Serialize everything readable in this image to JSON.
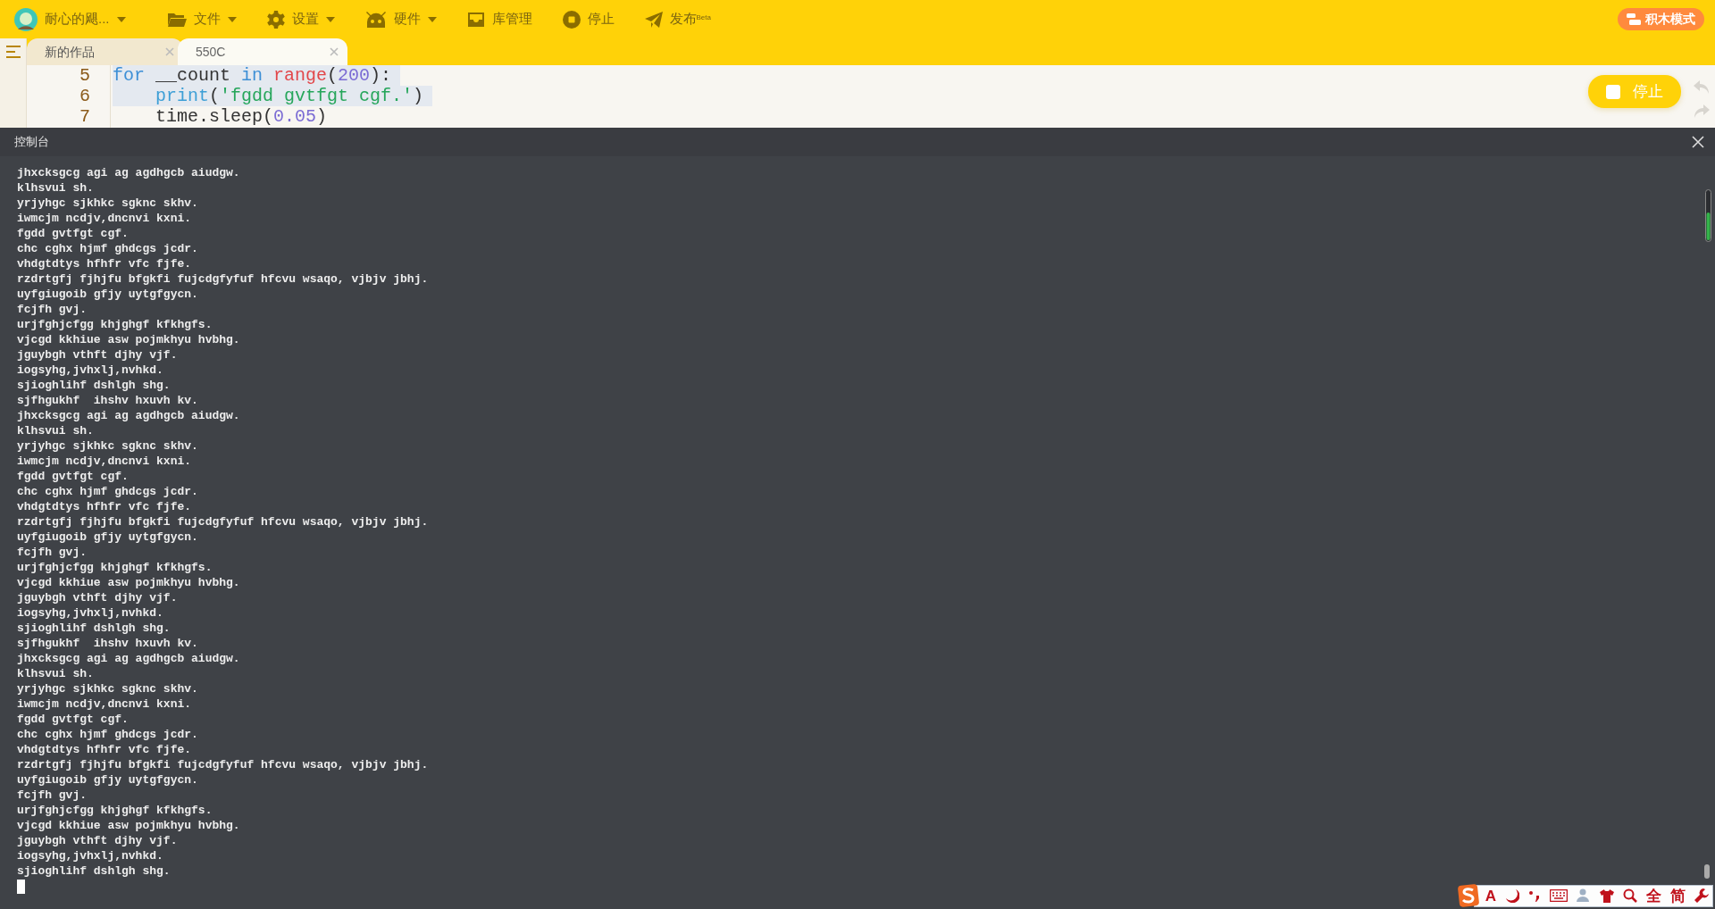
{
  "toolbar": {
    "user": {
      "name": "耐心的飓...",
      "dropdown": true
    },
    "menus": [
      {
        "kind": "folder",
        "label": "文件",
        "dropdown": true,
        "disabled": false
      },
      {
        "kind": "gear",
        "label": "设置",
        "dropdown": true,
        "disabled": false
      },
      {
        "kind": "robot",
        "label": "硬件",
        "dropdown": true,
        "disabled": false
      },
      {
        "kind": "box",
        "label": "库管理",
        "dropdown": false,
        "disabled": false
      },
      {
        "kind": "stop",
        "label": "停止",
        "dropdown": false,
        "disabled": false
      },
      {
        "kind": "send",
        "label": "发布$^{Beta}$",
        "dropdown": false,
        "disabled": false
      }
    ],
    "mode_button": "积木模式"
  },
  "tabs": [
    {
      "label": "新的作品",
      "selected": false
    },
    {
      "label": "550C",
      "selected": true
    }
  ],
  "editor": {
    "lines": [
      {
        "number": "5",
        "selected": true,
        "tokens": [
          {
            "color": "#3d8fd6",
            "text": "for"
          },
          {
            "color": "#333333",
            "text": " __count "
          },
          {
            "color": "#3d8fd6",
            "text": "in"
          },
          {
            "color": "#e2474a",
            "text": " range"
          },
          {
            "color": "#333333",
            "text": "("
          },
          {
            "color": "#7b6cd4",
            "text": "200"
          },
          {
            "color": "#333333",
            "text": "):"
          }
        ]
      },
      {
        "number": "6",
        "selected": true,
        "tokens": [
          {
            "color": "#3d9fd6",
            "text": "    print"
          },
          {
            "color": "#333333",
            "text": "("
          },
          {
            "color": "#26a65b",
            "text": "'fgdd gvtfgt cgf.'"
          },
          {
            "color": "#333333",
            "text": ")"
          }
        ]
      },
      {
        "number": "7",
        "selected": false,
        "tokens": [
          {
            "color": "#333333",
            "text": "    time.sleep("
          },
          {
            "color": "#7b6cd4",
            "text": "0.05"
          },
          {
            "color": "#333333",
            "text": ")"
          }
        ]
      }
    ],
    "stop_button": "停止"
  },
  "console": {
    "title": "控制台",
    "lines": [
      "jhxcksgcg agi ag agdhgcb aiudgw.",
      "klhsvui sh.",
      "yrjyhgc sjkhkc sgknc skhv.",
      "iwmcjm ncdjv,dncnvi kxni.",
      "fgdd gvtfgt cgf.",
      "chc cghx hjmf ghdcgs jcdr.",
      "vhdgtdtys hfhfr vfc fjfe.",
      "rzdrtgfj fjhjfu bfgkfi fujcdgfyfuf hfcvu wsaqo, vjbjv jbhj.",
      "uyfgiugoib gfjy uytgfgycn.",
      "fcjfh gvj.",
      "urjfghjcfgg khjghgf kfkhgfs.",
      "vjcgd kkhiue asw pojmkhyu hvbhg.",
      "jguybgh vthft djhy vjf.",
      "iogsyhg,jvhxlj,nvhkd.",
      "sjioghlihf dshlgh shg.",
      "sjfhgukhf  ihshv hxuvh kv.",
      "jhxcksgcg agi ag agdhgcb aiudgw.",
      "klhsvui sh.",
      "yrjyhgc sjkhkc sgknc skhv.",
      "iwmcjm ncdjv,dncnvi kxni.",
      "fgdd gvtfgt cgf.",
      "chc cghx hjmf ghdcgs jcdr.",
      "vhdgtdtys hfhfr vfc fjfe.",
      "rzdrtgfj fjhjfu bfgkfi fujcdgfyfuf hfcvu wsaqo, vjbjv jbhj.",
      "uyfgiugoib gfjy uytgfgycn.",
      "fcjfh gvj.",
      "urjfghjcfgg khjghgf kfkhgfs.",
      "vjcgd kkhiue asw pojmkhyu hvbhg.",
      "jguybgh vthft djhy vjf.",
      "iogsyhg,jvhxlj,nvhkd.",
      "sjioghlihf dshlgh shg.",
      "sjfhgukhf  ihshv hxuvh kv.",
      "jhxcksgcg agi ag agdhgcb aiudgw.",
      "klhsvui sh.",
      "yrjyhgc sjkhkc sgknc skhv.",
      "iwmcjm ncdjv,dncnvi kxni.",
      "fgdd gvtfgt cgf.",
      "chc cghx hjmf ghdcgs jcdr.",
      "vhdgtdtys hfhfr vfc fjfe.",
      "rzdrtgfj fjhjfu bfgkfi fujcdgfyfuf hfcvu wsaqo, vjbjv jbhj.",
      "uyfgiugoib gfjy uytgfgycn.",
      "fcjfh gvj.",
      "urjfghjcfgg khjghgf kfkhgfs.",
      "vjcgd kkhiue asw pojmkhyu hvbhg.",
      "jguybgh vthft djhy vjf.",
      "iogsyhg,jvhxlj,nvhkd.",
      "sjioghlihf dshlgh shg."
    ]
  },
  "ime_toolbar": {
    "items": [
      {
        "kind": "logo"
      },
      {
        "kind": "text",
        "label": "A"
      },
      {
        "kind": "moon"
      },
      {
        "kind": "punct"
      },
      {
        "kind": "keyboard"
      },
      {
        "kind": "user"
      },
      {
        "kind": "shirt"
      },
      {
        "kind": "search"
      },
      {
        "kind": "text",
        "label": "全"
      },
      {
        "kind": "text",
        "label": "简"
      },
      {
        "kind": "wrench"
      }
    ]
  }
}
